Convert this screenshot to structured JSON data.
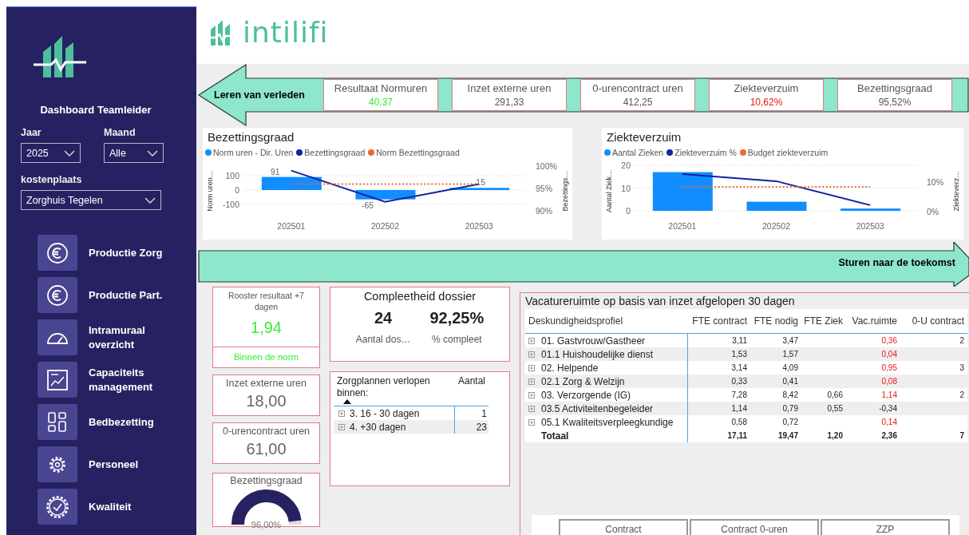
{
  "sidebar": {
    "title": "Dashboard Teamleider",
    "filters": [
      {
        "label": "Jaar",
        "value": "2025"
      },
      {
        "label": "Maand",
        "value": "Alle"
      },
      {
        "label": "kostenplaats",
        "value": "Zorghuis Tegelen"
      }
    ],
    "nav": [
      {
        "label": "Productie Zorg",
        "kind": "euro"
      },
      {
        "label": "Productie Part.",
        "kind": "euro"
      },
      {
        "label": "Intramuraal overzicht",
        "kind": "gauge"
      },
      {
        "label": "Capaciteits management",
        "kind": "chart"
      },
      {
        "label": "Bedbezetting",
        "kind": "tiles"
      },
      {
        "label": "Personeel",
        "kind": "gear"
      },
      {
        "label": "Kwaliteit",
        "kind": "badge"
      }
    ]
  },
  "header": {
    "logo_text": "intilifi"
  },
  "past_banner": {
    "label": "Leren van verleden",
    "kpis": [
      {
        "title": "Resultaat Normuren",
        "value": "40,37",
        "color": "#33ee33"
      },
      {
        "title": "Inzet externe uren",
        "value": "291,33",
        "color": "#555555"
      },
      {
        "title": "0-urencontract uren",
        "value": "412,25",
        "color": "#555555"
      },
      {
        "title": "Ziekteverzuim",
        "value": "10,62%",
        "color": "#ee1111"
      },
      {
        "title": "Bezettingsgraad",
        "value": "95,52%",
        "color": "#555555"
      }
    ]
  },
  "charts": [
    {
      "chart_data": {
        "type": "bar",
        "title": "Bezettingsgraad",
        "categories": [
          "202501",
          "202502",
          "202503"
        ],
        "ylabel": "Norm uren…",
        "y2label": "Bezettings…",
        "ylim": [
          -100,
          100
        ],
        "y2lim": [
          90,
          100
        ],
        "yticks": [
          100,
          0,
          -100
        ],
        "y2ticks": [
          {
            "value": 100,
            "label": "100%"
          },
          {
            "value": 95,
            "label": "95%"
          },
          {
            "value": 90,
            "label": "90%"
          }
        ],
        "grid": true,
        "value_labels": [
          [
            "91",
            "-65",
            "15"
          ],
          [
            null,
            null,
            null
          ]
        ],
        "series": [
          {
            "name": "Norm uren - Dir. Uren",
            "type": "bar",
            "color": "#118dff",
            "values": [
              91,
              -65,
              15
            ]
          },
          {
            "name": "Bezettingsgraad",
            "type": "line",
            "axis": "y2",
            "color": "#12239e",
            "values": [
              99,
              92,
              96
            ]
          }
        ],
        "ref_lines": [
          {
            "label": "Norm Bezettingsgraad",
            "value": 96,
            "axis": "y2",
            "color": "#e66c37"
          }
        ]
      }
    },
    {
      "chart_data": {
        "type": "bar",
        "title": "Ziekteverzuim",
        "categories": [
          "202501",
          "202502",
          "202503"
        ],
        "ylabel": "Aantal Ziek…",
        "y2label": "Ziekteverz…",
        "ylim": [
          0,
          20
        ],
        "y2lim": [
          0,
          15.7
        ],
        "yticks": [
          20,
          10,
          0
        ],
        "y2ticks": [
          {
            "value": 10,
            "label": "10%"
          },
          {
            "value": 0,
            "label": "0%"
          }
        ],
        "grid": true,
        "series": [
          {
            "name": "Aantal Zieken",
            "type": "bar",
            "color": "#118dff",
            "values": [
              17,
              4,
              1
            ]
          },
          {
            "name": "Ziekteverzuim %",
            "type": "line",
            "axis": "y2",
            "color": "#12239e",
            "values": [
              12.7,
              10.3,
              2.2
            ]
          }
        ],
        "ref_lines": [
          {
            "label": "Budget ziekteverzuim",
            "value": 8.4,
            "axis": "y2",
            "color": "#e66c37"
          }
        ]
      }
    }
  ],
  "future_banner": {
    "label": "Sturen naar de toekomst"
  },
  "rooster": {
    "title": "Rooster resultaat +7 dagen",
    "value": "1,94",
    "status": "Binnen de norm",
    "color": "#33ee33"
  },
  "kpi_cards": [
    {
      "title": "Inzet externe uren",
      "value": "18,00"
    },
    {
      "title": "0-urencontract uren",
      "value": "61,00"
    }
  ],
  "bezetting_gauge": {
    "title": "Bezettingsgraad",
    "value": "96,00%",
    "level": 0.96
  },
  "compleetheid": {
    "title": "Compleetheid dossier",
    "metrics": [
      {
        "value": "24",
        "label": "Aantal dos…"
      },
      {
        "value": "92,25%",
        "label": "% compleet"
      }
    ]
  },
  "zorgplannen": {
    "columns": [
      "Zorgplannen verlopen binnen:",
      "Aantal"
    ],
    "rows": [
      {
        "label": "3. 16 - 30 dagen",
        "value": "1"
      },
      {
        "label": "4. +30 dagen",
        "value": "23"
      }
    ]
  },
  "vacature": {
    "title": "Vacatureruimte op basis van inzet afgelopen 30 dagen",
    "columns": [
      "Deskundigheidsprofiel",
      "FTE contract",
      "FTE nodig",
      "FTE Ziek",
      "Vac.ruimte",
      "0-U contract"
    ],
    "rows": [
      {
        "cells": [
          "01. Gastvrouw/Gastheer",
          "3,11",
          "3,47",
          "",
          "0,36",
          "2"
        ],
        "alert": true
      },
      {
        "cells": [
          "01.1 Huishoudelijke dienst",
          "1,53",
          "1,57",
          "",
          "0,04",
          ""
        ],
        "alert": true
      },
      {
        "cells": [
          "02. Helpende",
          "3,14",
          "4,09",
          "",
          "0,95",
          "3"
        ],
        "alert": true
      },
      {
        "cells": [
          "02.1 Zorg & Welzijn",
          "0,33",
          "0,41",
          "",
          "0,08",
          ""
        ],
        "alert": true
      },
      {
        "cells": [
          "03. Verzorgende (IG)",
          "7,28",
          "8,42",
          "0,66",
          "1,14",
          "2"
        ],
        "alert": true
      },
      {
        "cells": [
          "03.5 Activiteitenbegeleider",
          "1,14",
          "0,79",
          "0,55",
          "-0,34",
          ""
        ],
        "alert": false
      },
      {
        "cells": [
          "05.1 Kwaliteitsverpleegkundige",
          "0,58",
          "0,72",
          "",
          "0,14",
          ""
        ],
        "alert": true
      }
    ],
    "total": {
      "cells": [
        "Totaal",
        "17,11",
        "19,47",
        "1,20",
        "2,36",
        "7"
      ]
    }
  },
  "type_buttons": [
    {
      "label": "Contract"
    },
    {
      "label": "Contract 0-uren"
    },
    {
      "label": "ZZP"
    }
  ]
}
